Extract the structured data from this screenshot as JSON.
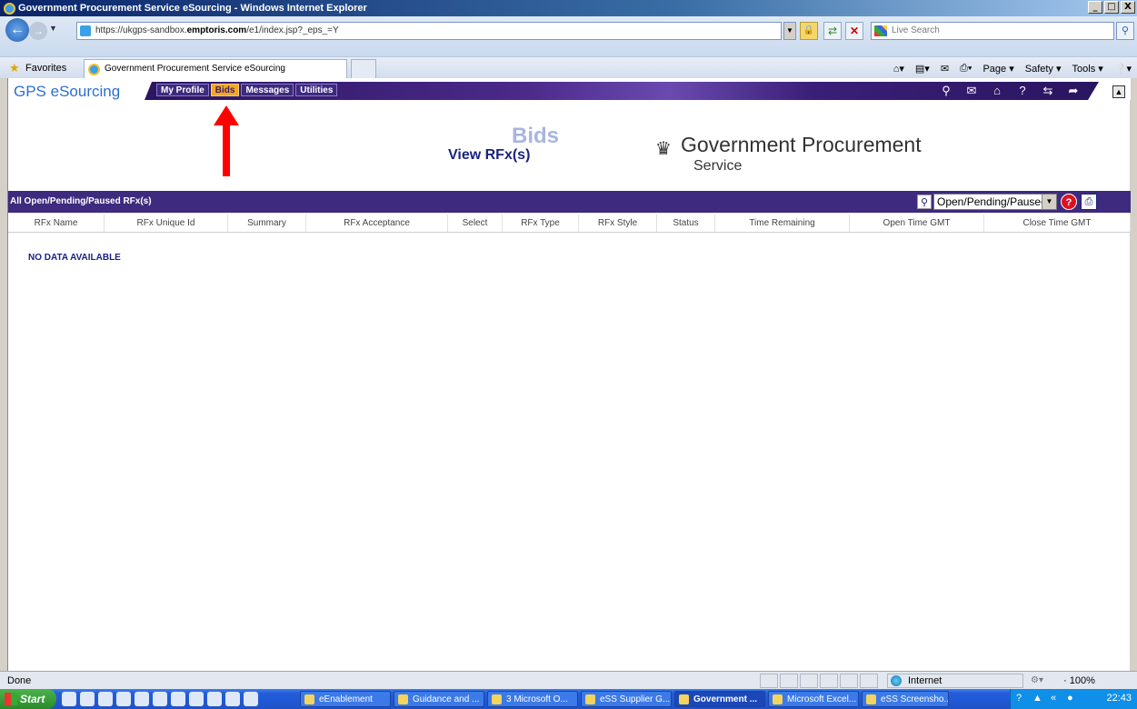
{
  "window": {
    "title": "Government Procurement Service eSourcing - Windows Internet Explorer",
    "buttons": [
      "_",
      "□",
      "X"
    ]
  },
  "address_bar": {
    "url_prefix": "https://ukgps-sandbox.",
    "url_domain": "emptoris.com",
    "url_suffix": "/e1/index.jsp?_eps_=Y",
    "search_placeholder": "Live Search"
  },
  "favorites_bar": {
    "favorites_label": "Favorites",
    "tab_title": "Government Procurement Service eSourcing",
    "commands": [
      "Page ▾",
      "Safety ▾",
      "Tools ▾"
    ]
  },
  "app": {
    "brand": "GPS eSourcing",
    "menu": [
      {
        "label": "My Profile",
        "active": false
      },
      {
        "label": "Bids",
        "active": true
      },
      {
        "label": "Messages",
        "active": false
      },
      {
        "label": "Utilities",
        "active": false
      }
    ],
    "page_heading": "View RFx(s)",
    "page_heading_ghost": "Bids",
    "logo_line1": "Government Procurement",
    "logo_line2": "Service"
  },
  "list": {
    "title": "All Open/Pending/Paused RFx(s)",
    "filter_value": "Open/Pending/Paused",
    "columns": [
      "RFx Name",
      "RFx Unique Id",
      "Summary",
      "RFx Acceptance",
      "Select",
      "RFx Type",
      "RFx Style",
      "Status",
      "Time Remaining",
      "Open Time GMT",
      "Close Time GMT"
    ],
    "empty_message": "NO DATA AVAILABLE"
  },
  "status_bar": {
    "text": "Done",
    "zone": "Internet",
    "zoom": "· 100%"
  },
  "taskbar": {
    "start_label": "Start",
    "tasks": [
      {
        "label": "eEnablement",
        "active": false
      },
      {
        "label": "Guidance and ...",
        "active": false
      },
      {
        "label": "3 Microsoft O...",
        "active": false
      },
      {
        "label": "eSS Supplier G...",
        "active": false
      },
      {
        "label": "Government ...",
        "active": true
      },
      {
        "label": "Microsoft Excel...",
        "active": false
      },
      {
        "label": "eSS Screensho...",
        "active": false
      }
    ],
    "clock": "22:43"
  },
  "colors": {
    "menu_band": "#3e2a7e",
    "active_tab": "#f5a623",
    "brand_blue": "#2b6fd6",
    "heading_navy": "#1a237e",
    "arrow_red": "#ff0000"
  }
}
